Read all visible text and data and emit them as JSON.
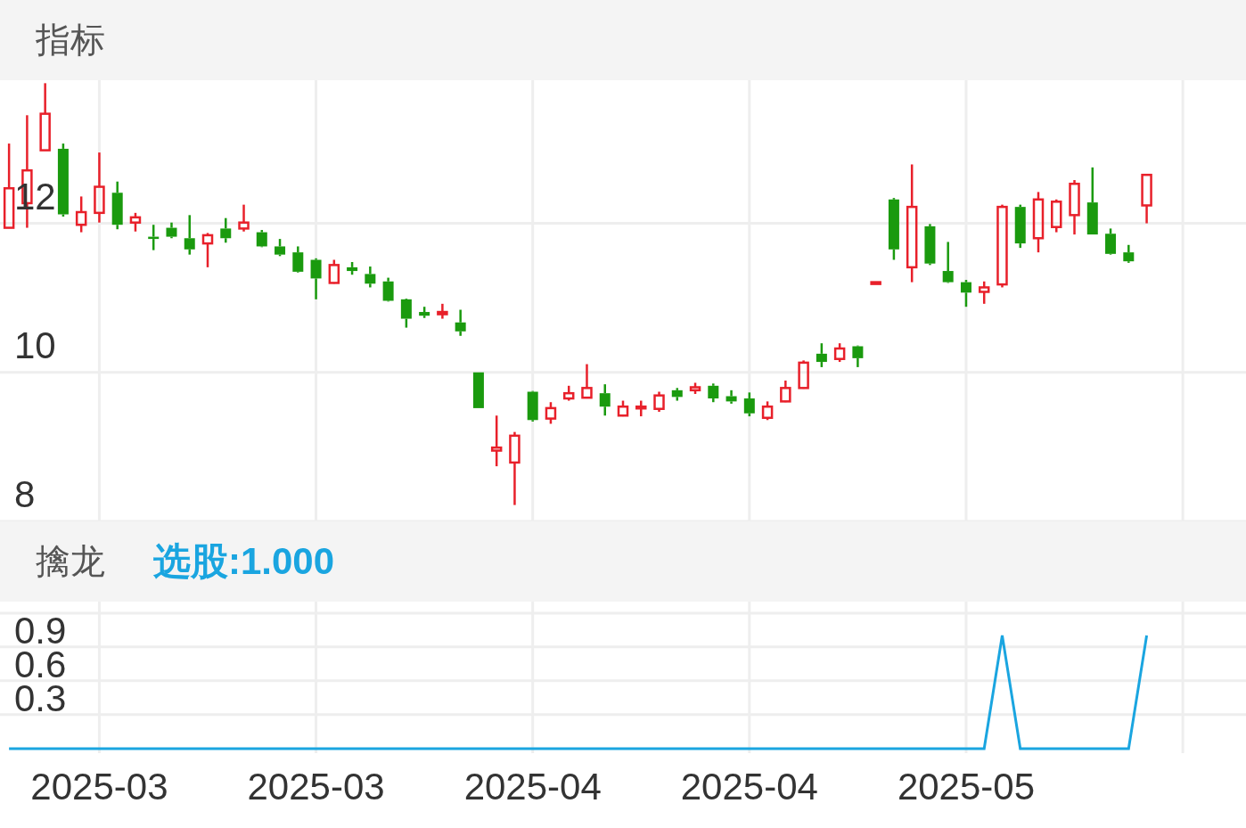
{
  "header": {
    "title": "指标"
  },
  "price_chart": {
    "chart_data": {
      "type": "candlestick",
      "ylim": [
        8.0,
        13.92
      ],
      "yticks": [
        8,
        10,
        12
      ],
      "grid": true,
      "categories": [
        null,
        null,
        null,
        null,
        null,
        null,
        null,
        null,
        null,
        null,
        null,
        null,
        null,
        null,
        null,
        null,
        null,
        null,
        null,
        null,
        null,
        null,
        null,
        null,
        null,
        null,
        null,
        null,
        null,
        null,
        null,
        null,
        null,
        null,
        null,
        null,
        null,
        null,
        null,
        null,
        null,
        null,
        null,
        null,
        null,
        null,
        null,
        null,
        null,
        null,
        null,
        null,
        null,
        null,
        null,
        null,
        null,
        null,
        null,
        null,
        null,
        null,
        null,
        null,
        null,
        null,
        null,
        null,
        null
      ],
      "ohlc": [
        [
          11.94,
          13.07,
          11.94,
          12.47
        ],
        [
          12.27,
          13.45,
          11.94,
          12.71
        ],
        [
          12.98,
          13.88,
          12.98,
          13.47
        ],
        [
          13.0,
          13.07,
          12.09,
          12.12
        ],
        [
          11.98,
          12.36,
          11.88,
          12.15
        ],
        [
          12.14,
          12.95,
          12.01,
          12.49
        ],
        [
          12.41,
          12.56,
          11.92,
          11.98
        ],
        [
          12.01,
          12.14,
          11.89,
          12.08
        ],
        [
          11.82,
          11.98,
          11.64,
          11.79
        ],
        [
          11.94,
          12.01,
          11.8,
          11.82
        ],
        [
          11.8,
          12.11,
          11.58,
          11.65
        ],
        [
          11.73,
          11.87,
          11.41,
          11.84
        ],
        [
          11.93,
          12.07,
          11.74,
          11.8
        ],
        [
          11.93,
          12.25,
          11.89,
          12.01
        ],
        [
          11.88,
          11.91,
          11.68,
          11.69
        ],
        [
          11.69,
          11.79,
          11.56,
          11.58
        ],
        [
          11.61,
          11.69,
          11.34,
          11.35
        ],
        [
          11.51,
          11.53,
          10.98,
          11.26
        ],
        [
          11.2,
          11.51,
          11.19,
          11.44
        ],
        [
          11.41,
          11.48,
          11.31,
          11.36
        ],
        [
          11.32,
          11.42,
          11.14,
          11.19
        ],
        [
          11.22,
          11.27,
          10.95,
          10.96
        ],
        [
          10.98,
          10.99,
          10.6,
          10.72
        ],
        [
          10.81,
          10.88,
          10.73,
          10.76
        ],
        [
          10.78,
          10.92,
          10.72,
          10.81
        ],
        [
          10.67,
          10.84,
          10.49,
          10.55
        ],
        [
          10.0,
          10.0,
          9.52,
          9.52
        ],
        [
          8.95,
          9.42,
          8.74,
          8.99
        ],
        [
          8.79,
          9.2,
          8.22,
          9.15
        ],
        [
          9.74,
          9.75,
          9.34,
          9.36
        ],
        [
          9.38,
          9.6,
          9.31,
          9.52
        ],
        [
          9.65,
          9.82,
          9.62,
          9.72
        ],
        [
          9.66,
          10.11,
          9.65,
          9.79
        ],
        [
          9.72,
          9.84,
          9.42,
          9.54
        ],
        [
          9.42,
          9.62,
          9.41,
          9.54
        ],
        [
          9.52,
          9.62,
          9.41,
          9.54
        ],
        [
          9.51,
          9.74,
          9.47,
          9.69
        ],
        [
          9.76,
          9.79,
          9.62,
          9.67
        ],
        [
          9.76,
          9.86,
          9.71,
          9.8
        ],
        [
          9.82,
          9.85,
          9.6,
          9.65
        ],
        [
          9.68,
          9.76,
          9.58,
          9.61
        ],
        [
          9.65,
          9.73,
          9.41,
          9.45
        ],
        [
          9.39,
          9.61,
          9.36,
          9.54
        ],
        [
          9.61,
          9.89,
          9.6,
          9.79
        ],
        [
          9.79,
          10.16,
          9.78,
          10.13
        ],
        [
          10.25,
          10.39,
          10.07,
          10.14
        ],
        [
          10.18,
          10.39,
          10.14,
          10.32
        ],
        [
          10.35,
          10.36,
          10.07,
          10.19
        ],
        [
          11.2,
          11.21,
          11.2,
          11.21
        ],
        [
          12.32,
          12.34,
          11.51,
          11.65
        ],
        [
          11.41,
          12.79,
          11.21,
          12.22
        ],
        [
          11.96,
          11.99,
          11.44,
          11.46
        ],
        [
          11.36,
          11.75,
          11.2,
          11.21
        ],
        [
          11.21,
          11.24,
          10.88,
          11.07
        ],
        [
          11.08,
          11.22,
          10.92,
          11.14
        ],
        [
          11.18,
          12.25,
          11.14,
          12.22
        ],
        [
          12.22,
          12.25,
          11.67,
          11.73
        ],
        [
          11.8,
          12.42,
          11.61,
          12.32
        ],
        [
          11.95,
          12.32,
          11.88,
          12.29
        ],
        [
          12.11,
          12.58,
          11.85,
          12.53
        ],
        [
          12.28,
          12.75,
          11.85,
          11.85
        ],
        [
          11.86,
          11.93,
          11.58,
          11.59
        ],
        [
          11.61,
          11.71,
          11.47,
          11.49
        ],
        [
          12.24,
          12.65,
          12.0,
          12.65
        ],
        null,
        null,
        null,
        null,
        null
      ]
    }
  },
  "signal_header": {
    "title": "擒龙",
    "value": "选股:1.000"
  },
  "signal_chart": {
    "chart_data": {
      "type": "line",
      "ylim": [
        -0.04,
        1.3
      ],
      "yticks": [
        0.3,
        0.6,
        0.9
      ],
      "grid": true,
      "categories": [
        null,
        null,
        null,
        null,
        null,
        "2025-03",
        null,
        null,
        null,
        null,
        null,
        null,
        null,
        null,
        null,
        null,
        null,
        "2025-03",
        null,
        null,
        null,
        null,
        null,
        null,
        null,
        null,
        null,
        null,
        null,
        "2025-04",
        null,
        null,
        null,
        null,
        null,
        null,
        null,
        null,
        null,
        null,
        null,
        "2025-04",
        null,
        null,
        null,
        null,
        null,
        null,
        null,
        null,
        null,
        null,
        null,
        "2025-05",
        null,
        null,
        null,
        null,
        null,
        null,
        null,
        null,
        null,
        null,
        null,
        null,
        null,
        null,
        null
      ],
      "series": [
        {
          "color": "#1aa5e0",
          "values": [
            0,
            0,
            0,
            0,
            0,
            0,
            0,
            0,
            0,
            0,
            0,
            0,
            0,
            0,
            0,
            0,
            0,
            0,
            0,
            0,
            0,
            0,
            0,
            0,
            0,
            0,
            0,
            0,
            0,
            0,
            0,
            0,
            0,
            0,
            0,
            0,
            0,
            0,
            0,
            0,
            0,
            0,
            0,
            0,
            0,
            0,
            0,
            0,
            0,
            0,
            0,
            0,
            0,
            0,
            0,
            1,
            0,
            0,
            0,
            0,
            0,
            0,
            0,
            1,
            null,
            null,
            null,
            null,
            null
          ]
        }
      ]
    }
  }
}
